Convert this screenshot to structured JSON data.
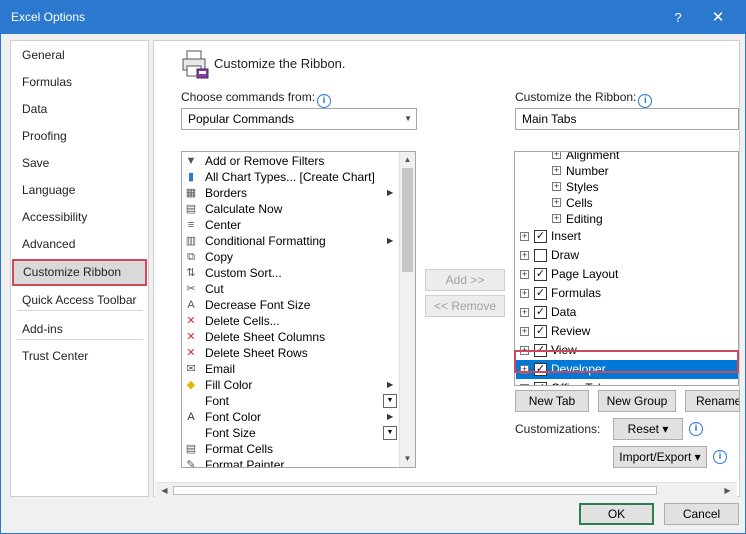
{
  "window": {
    "title": "Excel Options",
    "help_label": "?",
    "close_label": "✕"
  },
  "nav": {
    "items": [
      {
        "label": "General"
      },
      {
        "label": "Formulas"
      },
      {
        "label": "Data"
      },
      {
        "label": "Proofing"
      },
      {
        "label": "Save"
      },
      {
        "label": "Language"
      },
      {
        "label": "Accessibility"
      },
      {
        "label": "Advanced"
      },
      {
        "label": "Customize Ribbon"
      },
      {
        "label": "Quick Access Toolbar"
      },
      {
        "label": "Add-ins"
      },
      {
        "label": "Trust Center"
      }
    ],
    "selected": "Customize Ribbon"
  },
  "header": {
    "title": "Customize the Ribbon."
  },
  "left": {
    "choose_label": "Choose commands from:",
    "choose_value": "Popular Commands",
    "commands": [
      {
        "label": "Add or Remove Filters",
        "icon": "filter-icon"
      },
      {
        "label": "All Chart Types... [Create Chart]",
        "icon": "chart-icon"
      },
      {
        "label": "Borders",
        "icon": "borders-icon",
        "submenu": true
      },
      {
        "label": "Calculate Now",
        "icon": "calculator-icon"
      },
      {
        "label": "Center",
        "icon": "align-center-icon"
      },
      {
        "label": "Conditional Formatting",
        "icon": "conditional-formatting-icon",
        "submenu": true
      },
      {
        "label": "Copy",
        "icon": "copy-icon"
      },
      {
        "label": "Custom Sort...",
        "icon": "sort-icon"
      },
      {
        "label": "Cut",
        "icon": "scissors-icon"
      },
      {
        "label": "Decrease Font Size",
        "icon": "decrease-font-icon"
      },
      {
        "label": "Delete Cells...",
        "icon": "delete-cells-icon"
      },
      {
        "label": "Delete Sheet Columns",
        "icon": "delete-columns-icon"
      },
      {
        "label": "Delete Sheet Rows",
        "icon": "delete-rows-icon"
      },
      {
        "label": "Email",
        "icon": "email-icon"
      },
      {
        "label": "Fill Color",
        "icon": "fill-color-icon",
        "submenu": true
      },
      {
        "label": "Font",
        "icon": "",
        "dropdown": true
      },
      {
        "label": "Font Color",
        "icon": "font-color-icon",
        "submenu": true
      },
      {
        "label": "Font Size",
        "icon": "",
        "dropdown": true
      },
      {
        "label": "Format Cells",
        "icon": "format-cells-icon"
      },
      {
        "label": "Format Painter",
        "icon": "format-painter-icon"
      }
    ]
  },
  "middle": {
    "add_label": "Add >>",
    "remove_label": "<< Remove"
  },
  "right": {
    "customize_label": "Customize the Ribbon:",
    "customize_value": "Main Tabs",
    "tree": [
      {
        "label": "Alignment",
        "level": 2,
        "expander": "+",
        "checkbox": false,
        "partial": true
      },
      {
        "label": "Number",
        "level": 2,
        "expander": "+",
        "checkbox": false
      },
      {
        "label": "Styles",
        "level": 2,
        "expander": "+",
        "checkbox": false
      },
      {
        "label": "Cells",
        "level": 2,
        "expander": "+",
        "checkbox": false
      },
      {
        "label": "Editing",
        "level": 2,
        "expander": "+",
        "checkbox": false
      },
      {
        "label": "Insert",
        "level": 1,
        "expander": "+",
        "checkbox": true,
        "checked": true
      },
      {
        "label": "Draw",
        "level": 1,
        "expander": "+",
        "checkbox": true,
        "checked": false
      },
      {
        "label": "Page Layout",
        "level": 1,
        "expander": "+",
        "checkbox": true,
        "checked": true
      },
      {
        "label": "Formulas",
        "level": 1,
        "expander": "+",
        "checkbox": true,
        "checked": true
      },
      {
        "label": "Data",
        "level": 1,
        "expander": "+",
        "checkbox": true,
        "checked": true
      },
      {
        "label": "Review",
        "level": 1,
        "expander": "+",
        "checkbox": true,
        "checked": true
      },
      {
        "label": "View",
        "level": 1,
        "expander": "+",
        "checkbox": true,
        "checked": true
      },
      {
        "label": "Developer",
        "level": 1,
        "expander": "+",
        "checkbox": true,
        "checked": true,
        "selected": true
      },
      {
        "label": "Office Tab",
        "level": 1,
        "expander": "+",
        "checkbox": true,
        "checked": true
      }
    ],
    "new_tab_label": "New Tab",
    "new_group_label": "New Group",
    "rename_label": "Rename...",
    "customizations_label": "Customizations:",
    "reset_label": "Reset ▾",
    "import_export_label": "Import/Export ▾"
  },
  "footer": {
    "ok_label": "OK",
    "cancel_label": "Cancel"
  },
  "colors": {
    "title_bar": "#2b78cf",
    "selection": "#0078d7",
    "highlight": "#c94a5a",
    "ok_border": "#2c7d4f"
  }
}
